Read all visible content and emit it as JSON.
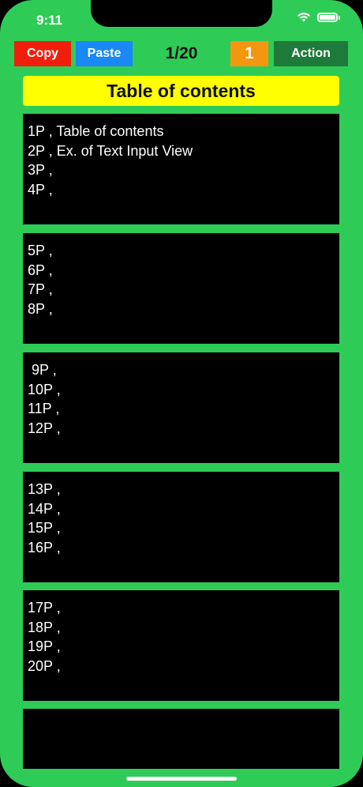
{
  "status_bar": {
    "time": "9:11",
    "icons": [
      "wifi-icon",
      "battery-icon"
    ]
  },
  "toolbar": {
    "copy_label": "Copy",
    "paste_label": "Paste",
    "page_counter": "1/20",
    "current_number": "1",
    "action_label": "Action"
  },
  "header": {
    "title": "Table of contents"
  },
  "pages": [
    {
      "lines": [
        "1P , Table of contents",
        "2P , Ex. of Text Input View",
        "3P ,",
        "4P ,"
      ]
    },
    {
      "lines": [
        "5P ,",
        "6P ,",
        "7P ,",
        "8P ,"
      ]
    },
    {
      "lines": [
        " 9P ,",
        "10P ,",
        "11P ,",
        "12P ,"
      ]
    },
    {
      "lines": [
        "13P ,",
        "14P ,",
        "15P ,",
        "16P ,"
      ]
    },
    {
      "lines": [
        "17P ,",
        "18P ,",
        "19P ,",
        "20P ,"
      ]
    },
    {
      "lines": []
    }
  ],
  "colors": {
    "background": "#2ecc57",
    "copy": "#f01f0d",
    "paste": "#1a88f6",
    "number": "#f5960f",
    "action": "#1e7a3a",
    "header": "#ffff00",
    "page_box": "#000000"
  }
}
